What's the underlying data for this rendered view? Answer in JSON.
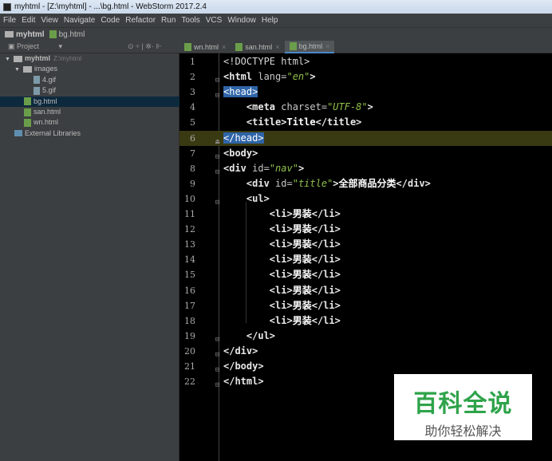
{
  "window": {
    "title": "myhtml - [Z:\\myhtml] - ...\\bg.html - WebStorm 2017.2.4"
  },
  "menu": [
    "File",
    "Edit",
    "View",
    "Navigate",
    "Code",
    "Refactor",
    "Run",
    "Tools",
    "VCS",
    "Window",
    "Help"
  ],
  "breadcrumb": {
    "project": "myhtml",
    "file": "bg.html"
  },
  "panel": {
    "title": "Project",
    "dropdown": "▾",
    "tools": "⊙ ÷ | ✲· ⊩"
  },
  "tree": [
    {
      "label": "myhtml",
      "sub": "Z:\\myhtml",
      "icon": "folder",
      "arrow": "▼",
      "depth": 0
    },
    {
      "label": "images",
      "icon": "folder",
      "arrow": "▼",
      "depth": 1
    },
    {
      "label": "4.gif",
      "icon": "gif",
      "depth": 3
    },
    {
      "label": "5.gif",
      "icon": "gif",
      "depth": 3
    },
    {
      "label": "bg.html",
      "icon": "html",
      "depth": 2,
      "selected": true
    },
    {
      "label": "san.html",
      "icon": "html",
      "depth": 2
    },
    {
      "label": "wn.html",
      "icon": "html",
      "depth": 2
    },
    {
      "label": "External Libraries",
      "icon": "lib",
      "depth": 1
    }
  ],
  "tabs": [
    {
      "label": "wn.html"
    },
    {
      "label": "san.html"
    },
    {
      "label": "bg.html",
      "active": true
    }
  ],
  "editor": {
    "current_line": 6,
    "lines": [
      [
        {
          "k": "plain",
          "t": "<!DOCTYPE html>"
        }
      ],
      [
        {
          "k": "tag",
          "t": "<html "
        },
        {
          "k": "attr",
          "t": "lang="
        },
        {
          "k": "str",
          "t": "\"en\""
        },
        {
          "k": "tag",
          "t": ">"
        }
      ],
      [
        {
          "k": "hl",
          "t": "<head>"
        }
      ],
      [
        {
          "k": "plain",
          "t": "    "
        },
        {
          "k": "tag",
          "t": "<meta "
        },
        {
          "k": "attr",
          "t": "charset="
        },
        {
          "k": "str",
          "t": "\"UTF-8\""
        },
        {
          "k": "tag",
          "t": ">"
        }
      ],
      [
        {
          "k": "plain",
          "t": "    "
        },
        {
          "k": "tag",
          "t": "<title>"
        },
        {
          "k": "txt",
          "t": "Title"
        },
        {
          "k": "tag",
          "t": "</title>"
        }
      ],
      [
        {
          "k": "hl",
          "t": "</head>"
        }
      ],
      [
        {
          "k": "tag",
          "t": "<body>"
        }
      ],
      [
        {
          "k": "tag",
          "t": "<div "
        },
        {
          "k": "attr",
          "t": "id="
        },
        {
          "k": "str",
          "t": "\"nav\""
        },
        {
          "k": "tag",
          "t": ">"
        }
      ],
      [
        {
          "k": "plain",
          "t": "    "
        },
        {
          "k": "tag",
          "t": "<div "
        },
        {
          "k": "attr",
          "t": "id="
        },
        {
          "k": "str",
          "t": "\"title\""
        },
        {
          "k": "tag",
          "t": ">"
        },
        {
          "k": "txt",
          "t": "全部商品分类"
        },
        {
          "k": "tag",
          "t": "</div>"
        }
      ],
      [
        {
          "k": "plain",
          "t": "    "
        },
        {
          "k": "tag",
          "t": "<ul>"
        }
      ],
      [
        {
          "k": "plain",
          "t": "        "
        },
        {
          "k": "tag",
          "t": "<li>"
        },
        {
          "k": "txt",
          "t": "男装"
        },
        {
          "k": "tag",
          "t": "</li>"
        }
      ],
      [
        {
          "k": "plain",
          "t": "        "
        },
        {
          "k": "tag",
          "t": "<li>"
        },
        {
          "k": "txt",
          "t": "男装"
        },
        {
          "k": "tag",
          "t": "</li>"
        }
      ],
      [
        {
          "k": "plain",
          "t": "        "
        },
        {
          "k": "tag",
          "t": "<li>"
        },
        {
          "k": "txt",
          "t": "男装"
        },
        {
          "k": "tag",
          "t": "</li>"
        }
      ],
      [
        {
          "k": "plain",
          "t": "        "
        },
        {
          "k": "tag",
          "t": "<li>"
        },
        {
          "k": "txt",
          "t": "男装"
        },
        {
          "k": "tag",
          "t": "</li>"
        }
      ],
      [
        {
          "k": "plain",
          "t": "        "
        },
        {
          "k": "tag",
          "t": "<li>"
        },
        {
          "k": "txt",
          "t": "男装"
        },
        {
          "k": "tag",
          "t": "</li>"
        }
      ],
      [
        {
          "k": "plain",
          "t": "        "
        },
        {
          "k": "tag",
          "t": "<li>"
        },
        {
          "k": "txt",
          "t": "男装"
        },
        {
          "k": "tag",
          "t": "</li>"
        }
      ],
      [
        {
          "k": "plain",
          "t": "        "
        },
        {
          "k": "tag",
          "t": "<li>"
        },
        {
          "k": "txt",
          "t": "男装"
        },
        {
          "k": "tag",
          "t": "</li>"
        }
      ],
      [
        {
          "k": "plain",
          "t": "        "
        },
        {
          "k": "tag",
          "t": "<li>"
        },
        {
          "k": "txt",
          "t": "男装"
        },
        {
          "k": "tag",
          "t": "</li>"
        }
      ],
      [
        {
          "k": "plain",
          "t": "    "
        },
        {
          "k": "tag",
          "t": "</ul>"
        }
      ],
      [
        {
          "k": "tag",
          "t": "</div>"
        }
      ],
      [
        {
          "k": "tag",
          "t": "</body>"
        }
      ],
      [
        {
          "k": "tag",
          "t": "</html>"
        }
      ]
    ],
    "folds": {
      "2": "⊟",
      "3": "⊟",
      "6": "⏏",
      "7": "⊟",
      "8": "⊟",
      "10": "⊟",
      "19": "⊟",
      "20": "⊟",
      "21": "⊟",
      "22": "⊟"
    }
  },
  "watermark": {
    "title": "百科全说",
    "subtitle": "助你轻松解决"
  }
}
